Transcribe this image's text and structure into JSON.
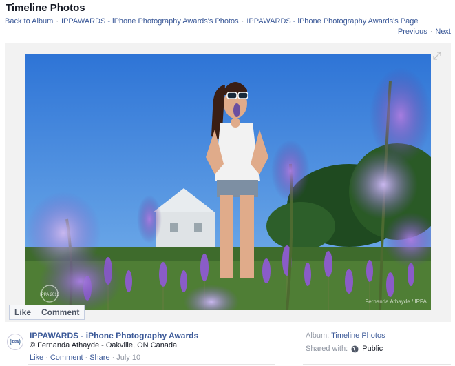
{
  "page": {
    "title": "Timeline Photos"
  },
  "breadcrumb": {
    "back": "Back to Album",
    "photos": "IPPAWARDS - iPhone Photography Awards's Photos",
    "page": "IPPAWARDS - iPhone Photography Awards's Page",
    "separator": "·"
  },
  "nav": {
    "previous": "Previous",
    "next": "Next",
    "separator": "·"
  },
  "photo": {
    "watermark_left": "IPPA 2013",
    "watermark_right": "Fernanda Athayde / IPPA"
  },
  "action_bar": {
    "like": "Like",
    "comment": "Comment"
  },
  "post": {
    "author": "IPPAWARDS - iPhone Photography Awards",
    "avatar_text": "IPPA",
    "caption": "© Fernanda Athayde - Oakville, ON Canada",
    "like": "Like",
    "comment": "Comment",
    "share": "Share",
    "date": "July 10",
    "separator": "·"
  },
  "sidebar": {
    "album_label": "Album:",
    "album_name": "Timeline Photos",
    "shared_label": "Shared with:",
    "shared_value": "Public"
  },
  "colors": {
    "link": "#3b5998",
    "sky": "#3a82d8",
    "lavender": "#8a5cc8"
  }
}
